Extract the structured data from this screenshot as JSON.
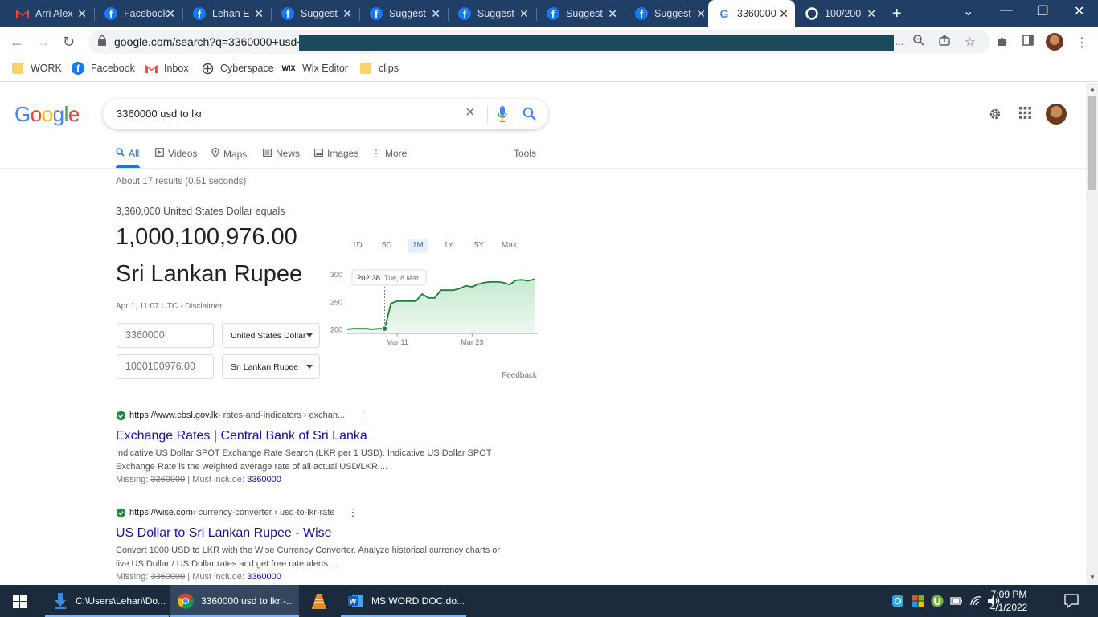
{
  "browser": {
    "tabs": [
      {
        "title": "Arri Alex",
        "icon": "gmail-icon"
      },
      {
        "title": "Facebook",
        "icon": "facebook-icon"
      },
      {
        "title": "Lehan E",
        "icon": "facebook-icon"
      },
      {
        "title": "Suggest",
        "icon": "facebook-icon"
      },
      {
        "title": "Suggest",
        "icon": "facebook-icon"
      },
      {
        "title": "Suggest",
        "icon": "facebook-icon"
      },
      {
        "title": "Suggest",
        "icon": "facebook-icon"
      },
      {
        "title": "Suggest",
        "icon": "facebook-icon"
      },
      {
        "title": "3360000",
        "icon": "google-icon",
        "active": true
      },
      {
        "title": "100/200",
        "icon": "google-icon"
      }
    ],
    "address": "google.com/search?q=3360000+usd+",
    "address_tail": "...",
    "bookmarks": [
      {
        "label": "WORK",
        "icon": "folder-icon"
      },
      {
        "label": "Facebook",
        "icon": "facebook-icon"
      },
      {
        "label": "Inbox",
        "icon": "gmail-icon"
      },
      {
        "label": "Cyberspace",
        "icon": "cyberspace-icon"
      },
      {
        "label": "Wix Editor",
        "icon": "wix-icon"
      },
      {
        "label": "clips",
        "icon": "folder-icon"
      }
    ]
  },
  "google": {
    "logo_letters": [
      "G",
      "o",
      "o",
      "g",
      "l",
      "e"
    ],
    "logo_colors": [
      "#4285f4",
      "#ea4335",
      "#fbbc05",
      "#4285f4",
      "#34a853",
      "#ea4335"
    ],
    "query": "3360000 usd to lkr",
    "tabs": [
      {
        "label": "All",
        "icon": "search-icon",
        "active": true
      },
      {
        "label": "Videos",
        "icon": "video-icon"
      },
      {
        "label": "Maps",
        "icon": "map-pin-icon"
      },
      {
        "label": "News",
        "icon": "news-icon"
      },
      {
        "label": "Images",
        "icon": "image-icon"
      },
      {
        "label": "More",
        "icon": "more-vertical-icon"
      }
    ],
    "tools_label": "Tools",
    "stats": "About 17 results (0.51 seconds)"
  },
  "converter": {
    "equals_line": "3,360,000 United States Dollar equals",
    "amount": "1,000,100,976.00",
    "currency": "Sri Lankan Rupee",
    "timestamp": "Apr 1, 11:07 UTC · Disclaimer",
    "from_value": "3360000",
    "from_currency": "United States Dollar",
    "to_value": "1000100976.00",
    "to_currency": "Sri Lankan Rupee",
    "ranges": [
      "1D",
      "5D",
      "1M",
      "1Y",
      "5Y",
      "Max"
    ],
    "active_range": "1M",
    "feedback": "Feedback",
    "accent": "#188038"
  },
  "chart_data": {
    "type": "area",
    "x": [
      0,
      1,
      2,
      3,
      4,
      5,
      6,
      7,
      8,
      9,
      10,
      11,
      12,
      13,
      14,
      15,
      16,
      17,
      18,
      19,
      20,
      21,
      22,
      23,
      24,
      25,
      26,
      27,
      28,
      29,
      30
    ],
    "values": [
      201,
      202,
      202,
      202,
      201,
      202,
      202,
      248,
      252,
      252,
      252,
      252,
      265,
      258,
      258,
      272,
      272,
      272,
      275,
      280,
      278,
      283,
      286,
      287,
      287,
      286,
      282,
      290,
      291,
      289,
      292
    ],
    "x_tick_labels": [
      "Mar 11",
      "Mar 23"
    ],
    "x_tick_positions": [
      8,
      20
    ],
    "y_tick_labels": [
      "300",
      "250",
      "200"
    ],
    "y_ticks": [
      300,
      250,
      200
    ],
    "ylim": [
      195,
      300
    ],
    "tooltip_value": "202.38",
    "tooltip_date": "Tue, 8 Mar",
    "tooltip_index": 6
  },
  "results": [
    {
      "url": "https://www.cbsl.gov.lk",
      "crumbs": " › rates-and-indicators › exchan...",
      "title": "Exchange Rates | Central Bank of Sri Lanka",
      "snippet": "Indicative US Dollar SPOT Exchange Rate Search (LKR per 1 USD). Indicative US Dollar SPOT Exchange Rate is the weighted average rate of all actual USD/LKR ...",
      "missing_label": "Missing: ",
      "missing_term": "3360000",
      "must_label": " | Must include: ",
      "must_term": "3360000"
    },
    {
      "url": "https://wise.com",
      "crumbs": " › currency-converter › usd-to-lkr-rate",
      "title": "US Dollar to Sri Lankan Rupee - Wise",
      "snippet": "Convert 1000 USD to LKR with the Wise Currency Converter. Analyze historical currency charts or live US Dollar / US Dollar rates and get free rate alerts ...",
      "missing_label": "Missing: ",
      "missing_term": "3360000",
      "must_label": " | Must include: ",
      "must_term": "3360000"
    }
  ],
  "taskbar": {
    "items": [
      {
        "label": "C:\\Users\\Lehan\\Do...",
        "icon": "download-icon"
      },
      {
        "label": "3360000 usd to lkr -...",
        "icon": "chrome-icon",
        "selected": true
      },
      {
        "label": "",
        "icon": "vlc-icon"
      },
      {
        "label": "MS WORD DOC.do...",
        "icon": "word-icon"
      }
    ],
    "time": "7:09 PM",
    "date": "4/1/2022"
  }
}
